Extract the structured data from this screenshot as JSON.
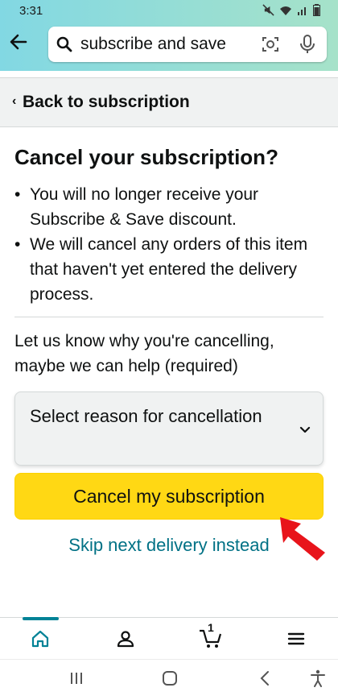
{
  "status_bar": {
    "time": "3:31",
    "icons": [
      "mute-icon",
      "wifi-icon",
      "signal-icon",
      "battery-icon"
    ]
  },
  "header": {
    "search": {
      "value": "subscribe and save"
    },
    "icons": [
      "back-arrow-icon",
      "search-icon",
      "camera-lens-icon",
      "microphone-icon"
    ],
    "gradient": [
      "#82d8e3",
      "#a6e2c9"
    ]
  },
  "back_bar": {
    "label": "Back to subscription"
  },
  "main": {
    "title": "Cancel your subscription?",
    "bullets": [
      "You will no longer receive your Subscribe & Save discount.",
      "We will cancel any orders of this item that haven't yet entered the delivery process."
    ],
    "reason_prompt": "Let us know why you're cancelling, maybe we can help (required)",
    "reason_select": {
      "selected": "Select reason for cancellation"
    },
    "cancel_button": "Cancel my subscription",
    "skip_link": "Skip next delivery instead"
  },
  "bottom_nav": {
    "items": [
      "home-icon",
      "account-icon",
      "cart-icon",
      "menu-icon"
    ],
    "cart_count": "1",
    "active": "home-icon"
  },
  "android_nav": {
    "items": [
      "recent-apps-icon",
      "home-button-icon",
      "back-icon",
      "accessibility-icon"
    ]
  },
  "colors": {
    "button_yellow": "#ffd814",
    "link_teal": "#007185",
    "nav_active": "#008296",
    "annotation_arrow": "#e8141b"
  }
}
